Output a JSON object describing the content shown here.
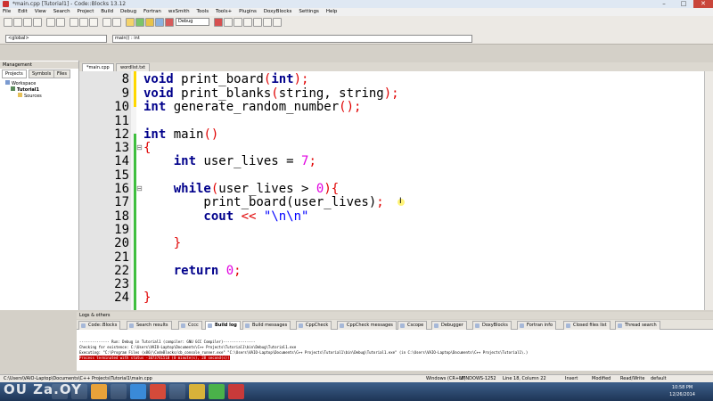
{
  "window": {
    "title": "*main.cpp [Tutorial1] - Code::Blocks 13.12",
    "minimize": "–",
    "maximize": "□",
    "close": "✕"
  },
  "menu": [
    "File",
    "Edit",
    "View",
    "Search",
    "Project",
    "Build",
    "Debug",
    "Fortran",
    "wxSmith",
    "Tools",
    "Tools+",
    "Plugins",
    "DoxyBlocks",
    "Settings",
    "Help"
  ],
  "toolbar": {
    "build_target": "Debug",
    "scope": "<global>",
    "function": "main() : int"
  },
  "management": {
    "title": "Management",
    "tabs": [
      "Projects",
      "Symbols",
      "Files"
    ],
    "tree": [
      "Workspace",
      "Tutorial1",
      "Sources"
    ]
  },
  "editor": {
    "tabs": [
      "*main.cpp",
      "wordlist.txt"
    ],
    "line_numbers": [
      "8",
      "9",
      "10",
      "11",
      "12",
      "13",
      "14",
      "15",
      "16",
      "17",
      "18",
      "19",
      "20",
      "21",
      "22",
      "23",
      "24"
    ]
  },
  "logs": {
    "title": "Logs & others",
    "tabs": [
      "Code::Blocks",
      "Search results",
      "Cccc",
      "Build log",
      "Build messages",
      "CppCheck",
      "CppCheck messages",
      "Cscope",
      "Debugger",
      "DoxyBlocks",
      "Fortran info",
      "Closed files list",
      "Thread search"
    ],
    "lines": [
      "-------------- Run: Debug in Tutorial1 (compiler: GNU GCC Compiler)---------------",
      "Checking for existence: C:\\Users\\VAIO-Laptop\\Documents\\C++ Projects\\Tutorial1\\bin\\Debug\\Tutorial1.exe",
      "Executing: \"C:\\Program Files (x86)\\CodeBlocks/cb_console_runner.exe\" \"C:\\Users\\VAIO-Laptop\\Documents\\C++ Projects\\Tutorial1\\bin\\Debug\\Tutorial1.exe\"  (in C:\\Users\\VAIO-Laptop\\Documents\\C++ Projects\\Tutorial1\\.)",
      "Process terminated with status -1073741510 (0 minute(s), 28 second(s))"
    ]
  },
  "status": {
    "path": "C:\\Users\\VAIO-Laptop\\Documents\\C++ Projects\\Tutorial1\\main.cpp",
    "eol": "Windows (CR+LF)",
    "encoding": "WINDOWS-1252",
    "position": "Line 18, Column 22",
    "mode": "Insert",
    "modified": "Modified",
    "rw": "Read/Write",
    "profile": "default"
  },
  "taskbar": {
    "time": "10:58 PM",
    "date": "12/26/2014"
  },
  "watermark": "OU Za.OY",
  "colors": {
    "keyword": "#00008b",
    "number": "#e000e0",
    "string": "#0000ff",
    "operator": "#e00000",
    "change_marker_saved": "#3fbf3f",
    "change_marker_unsaved": "#ffd800"
  }
}
